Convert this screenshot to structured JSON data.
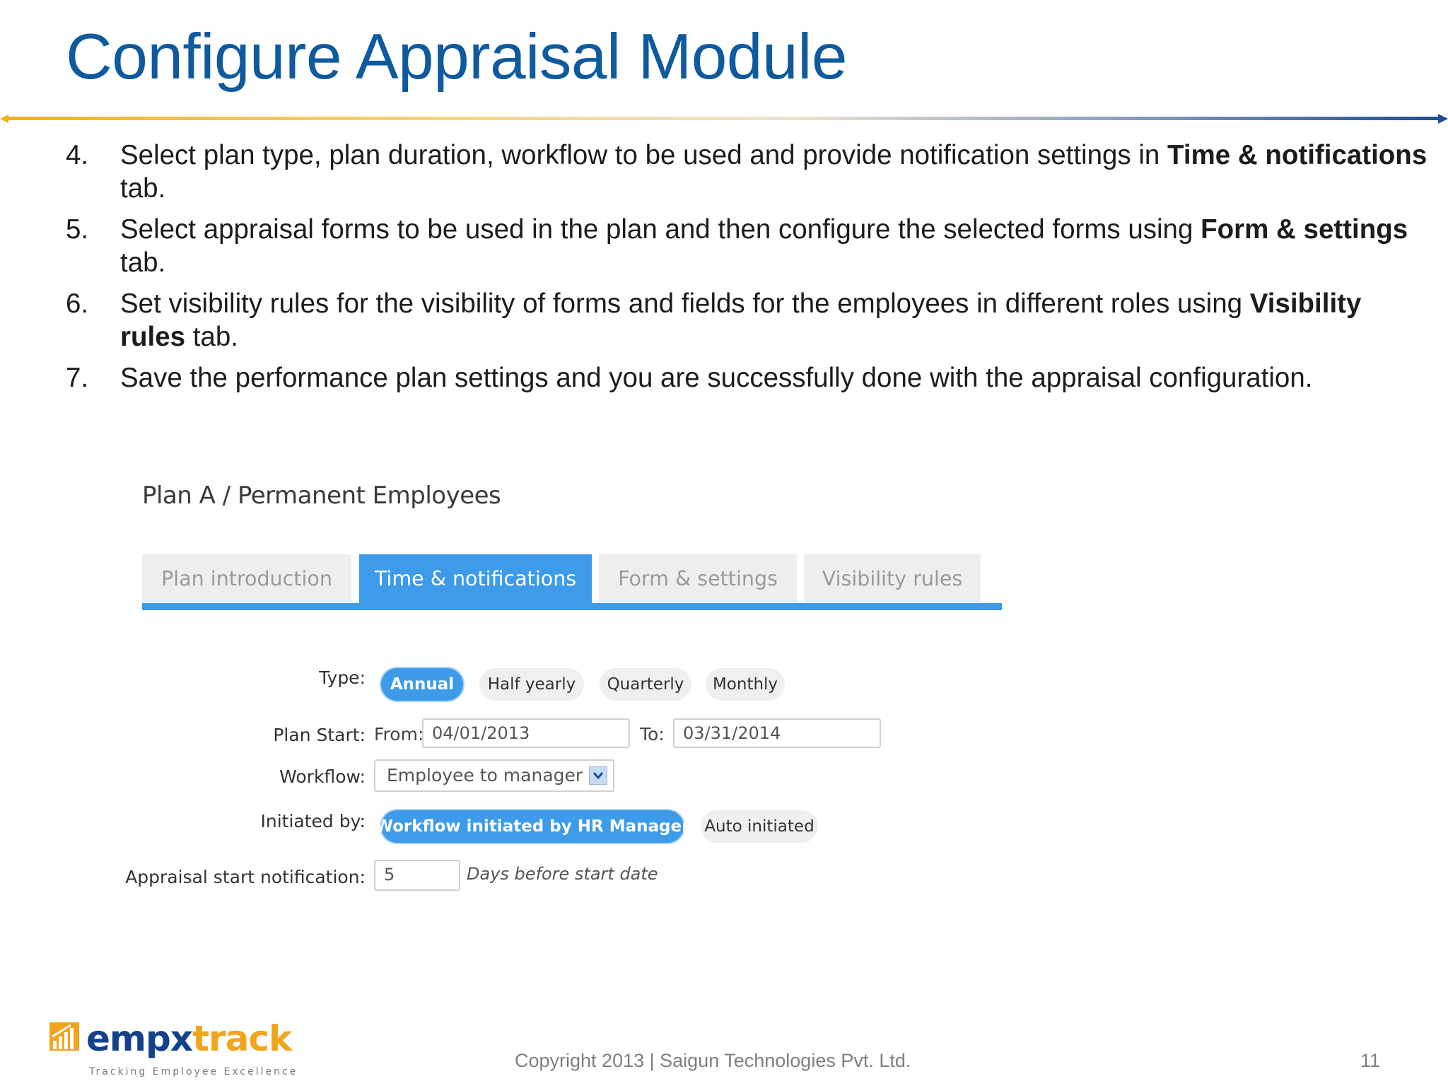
{
  "slide": {
    "title": "Configure Appraisal Module",
    "footer": "Copyright 2013 | Saigun Technologies Pvt. Ltd.",
    "page_number": "11"
  },
  "steps": [
    {
      "num": "4.",
      "text_a": "Select plan type, plan duration, workflow to be used and provide notification settings in ",
      "bold": "Time & notifications",
      "text_b": " tab."
    },
    {
      "num": "5.",
      "text_a": "Select appraisal forms to be used in the plan and then configure the selected forms using ",
      "bold": "Form & settings",
      "text_b": " tab."
    },
    {
      "num": "6.",
      "text_a": "Set visibility rules for the visibility of forms and fields for the employees in different roles using ",
      "bold": "Visibility rules",
      "text_b": " tab."
    },
    {
      "num": "7.",
      "text_a": "Save the performance plan settings and you are successfully done with the appraisal configuration.",
      "bold": "",
      "text_b": ""
    }
  ],
  "plan": {
    "title": "Plan A / Permanent Employees",
    "tabs": [
      {
        "label": "Plan introduction",
        "active": false
      },
      {
        "label": "Time & notifications",
        "active": true
      },
      {
        "label": "Form & settings",
        "active": false
      },
      {
        "label": "Visibility rules",
        "active": false
      }
    ]
  },
  "form": {
    "type_label": "Type:",
    "type_options": [
      "Annual",
      "Half yearly",
      "Quarterly",
      "Monthly"
    ],
    "type_selected": "Annual",
    "plan_start_label": "Plan Start:",
    "from_label": "From:",
    "from_value": "04/01/2013",
    "to_label": "To:",
    "to_value": "03/31/2014",
    "workflow_label": "Workflow:",
    "workflow_value": "Employee to manager to HR",
    "initiated_label": "Initiated by:",
    "initiated_options": [
      "Workflow initiated by HR Manager",
      "Auto initiated"
    ],
    "initiated_selected": "Workflow initiated by HR Manager",
    "notification_label": "Appraisal start notification:",
    "notification_value": "5",
    "notification_hint": "Days before start date"
  },
  "logo": {
    "word_part1": "empx",
    "word_part2": "track",
    "tagline": "Tracking Employee Excellence"
  },
  "colors": {
    "title": "#0f5a9e",
    "accent_blue": "#3d9be9",
    "divider_left": "#f2b01e",
    "divider_right": "#1d4e94"
  }
}
